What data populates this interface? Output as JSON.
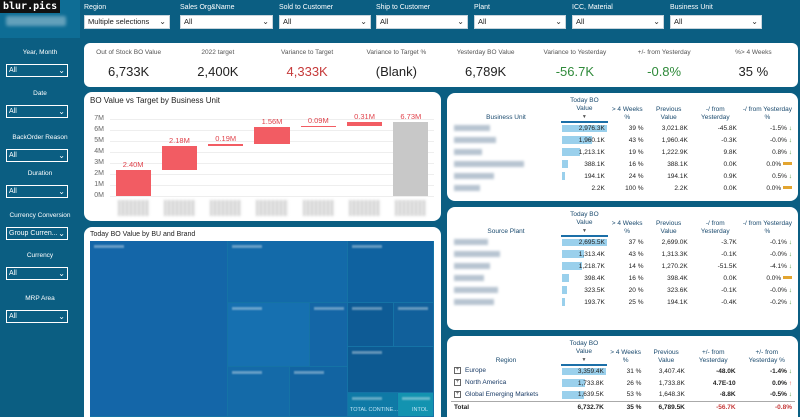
{
  "watermark": "blur.pics",
  "filters": [
    {
      "label": "Region",
      "value": "Multiple selections"
    },
    {
      "label": "Sales Org&Name",
      "value": "All"
    },
    {
      "label": "Sold to Customer",
      "value": "All"
    },
    {
      "label": "Ship to Customer",
      "value": "All"
    },
    {
      "label": "Plant",
      "value": "All"
    },
    {
      "label": "ICC, Material",
      "value": "All"
    },
    {
      "label": "Business Unit",
      "value": "All"
    }
  ],
  "sidebar": [
    {
      "label": "Year, Month",
      "value": "All"
    },
    {
      "label": "Date",
      "value": "All"
    },
    {
      "label": "BackOrder Reason",
      "value": "All"
    },
    {
      "label": "Duration",
      "value": "All"
    },
    {
      "label": "Currency Conversion",
      "value": "Group Curren..."
    },
    {
      "label": "Currency",
      "value": "All"
    },
    {
      "label": "MRP Area",
      "value": "All"
    }
  ],
  "kpis": [
    {
      "label": "Out of Stock BO Value",
      "value": "6,733K",
      "color": "#222222"
    },
    {
      "label": "2022 target",
      "value": "2,400K",
      "color": "#222222"
    },
    {
      "label": "Variance to Target",
      "value": "4,333K",
      "color": "#c63a3a"
    },
    {
      "label": "Variance to Target %",
      "value": "(Blank)",
      "color": "#222222"
    },
    {
      "label": "Yesterday BO Value",
      "value": "6,789K",
      "color": "#222222"
    },
    {
      "label": "Variance to Yesterday",
      "value": "-56.7K",
      "color": "#2f8a3a"
    },
    {
      "label": "+/- from Yesterday",
      "value": "-0.8%",
      "color": "#2f8a3a"
    },
    {
      "label": "%> 4 Weeks",
      "value": "35 %",
      "color": "#222222"
    }
  ],
  "waterfall": {
    "title": "BO Value vs Target by Business Unit",
    "y_ticks": [
      "7M",
      "6M",
      "5M",
      "4M",
      "3M",
      "2M",
      "1M",
      "0M"
    ],
    "ymax": 7.5
  },
  "chart_data": {
    "type": "bar",
    "title": "BO Value vs Target by Business Unit",
    "ylim": [
      0,
      7.5
    ],
    "values": [
      2.4,
      2.18,
      0.19,
      1.56,
      0.09,
      0.31,
      6.73
    ],
    "labels": [
      "2.40M",
      "2.18M",
      "0.19M",
      "1.56M",
      "0.09M",
      "0.31M",
      "6.73M"
    ],
    "total_index": 6,
    "colors": {
      "increase": "#f25c63",
      "total": "#c8c8c8"
    }
  },
  "treemap": {
    "title": "Today BO Value by BU and Brand",
    "labels": [
      "TOTAL CONTINE...",
      "INTOL"
    ]
  },
  "bu_table": {
    "headers": [
      "Business Unit",
      "Today BO Value",
      "> 4 Weeks %",
      "Previous Value",
      "-/ from Yesterday",
      "-/ from Yesterday %"
    ],
    "rows": [
      {
        "today": "2,976.3K",
        "w4": "39 %",
        "prev": "3,021.8K",
        "diff": "-45.8K",
        "pct": "-1.5%",
        "trend": "down",
        "bar": 1.0
      },
      {
        "today": "1,960.1K",
        "w4": "43 %",
        "prev": "1,960.4K",
        "diff": "-0.3K",
        "pct": "-0.0%",
        "trend": "down",
        "bar": 0.66
      },
      {
        "today": "1,213.1K",
        "w4": "19 %",
        "prev": "1,222.9K",
        "diff": "9.8K",
        "pct": "0.8%",
        "trend": "down",
        "bar": 0.41
      },
      {
        "today": "388.1K",
        "w4": "16 %",
        "prev": "388.1K",
        "diff": "0.0K",
        "pct": "0.0%",
        "trend": "flat",
        "bar": 0.13
      },
      {
        "today": "194.1K",
        "w4": "24 %",
        "prev": "194.1K",
        "diff": "0.9K",
        "pct": "0.5%",
        "trend": "down",
        "bar": 0.07
      },
      {
        "today": "2.2K",
        "w4": "100 %",
        "prev": "2.2K",
        "diff": "0.0K",
        "pct": "0.0%",
        "trend": "flat",
        "bar": 0.0
      }
    ]
  },
  "plant_table": {
    "headers": [
      "Source Plant",
      "Today BO Value",
      "> 4 Weeks %",
      "Previous Value",
      "-/ from Yesterday",
      "-/ from Yesterday %"
    ],
    "rows": [
      {
        "today": "2,695.5K",
        "w4": "37 %",
        "prev": "2,699.0K",
        "diff": "-3.7K",
        "pct": "-0.1%",
        "trend": "down",
        "bar": 1.0
      },
      {
        "today": "1,313.4K",
        "w4": "43 %",
        "prev": "1,313.3K",
        "diff": "-0.1K",
        "pct": "-0.0%",
        "trend": "down",
        "bar": 0.49
      },
      {
        "today": "1,218.7K",
        "w4": "14 %",
        "prev": "1,270.2K",
        "diff": "-51.5K",
        "pct": "-4.1%",
        "trend": "down",
        "bar": 0.45
      },
      {
        "today": "398.4K",
        "w4": "16 %",
        "prev": "398.4K",
        "diff": "0.0K",
        "pct": "0.0%",
        "trend": "flat",
        "bar": 0.15
      },
      {
        "today": "323.5K",
        "w4": "20 %",
        "prev": "323.6K",
        "diff": "-0.1K",
        "pct": "-0.0%",
        "trend": "down",
        "bar": 0.12
      },
      {
        "today": "193.7K",
        "w4": "25 %",
        "prev": "194.1K",
        "diff": "-0.4K",
        "pct": "-0.2%",
        "trend": "down",
        "bar": 0.07
      }
    ]
  },
  "region_table": {
    "headers": [
      "Region",
      "Today BO Value",
      "> 4 Weeks %",
      "Previous Value",
      "+/- from Yesterday",
      "+/- from Yesterday %"
    ],
    "rows": [
      {
        "name": "Europe",
        "today": "3,359.4K",
        "w4": "31 %",
        "prev": "3,407.4K",
        "diff": "-48.0K",
        "pct": "-1.4%",
        "trend": "down",
        "bar": 1.0
      },
      {
        "name": "North America",
        "today": "1,733.8K",
        "w4": "26 %",
        "prev": "1,733.8K",
        "diff": "4.7E-10",
        "pct": "0.0%",
        "trend": "up",
        "bar": 0.52
      },
      {
        "name": "Global Emerging Markets",
        "today": "1,639.5K",
        "w4": "53 %",
        "prev": "1,648.3K",
        "diff": "-8.8K",
        "pct": "-0.5%",
        "trend": "down",
        "bar": 0.49
      }
    ],
    "total": {
      "name": "Total",
      "today": "6,732.7K",
      "w4": "35 %",
      "prev": "6,789.5K",
      "diff": "-56.7K",
      "pct": "-0.8%"
    }
  }
}
